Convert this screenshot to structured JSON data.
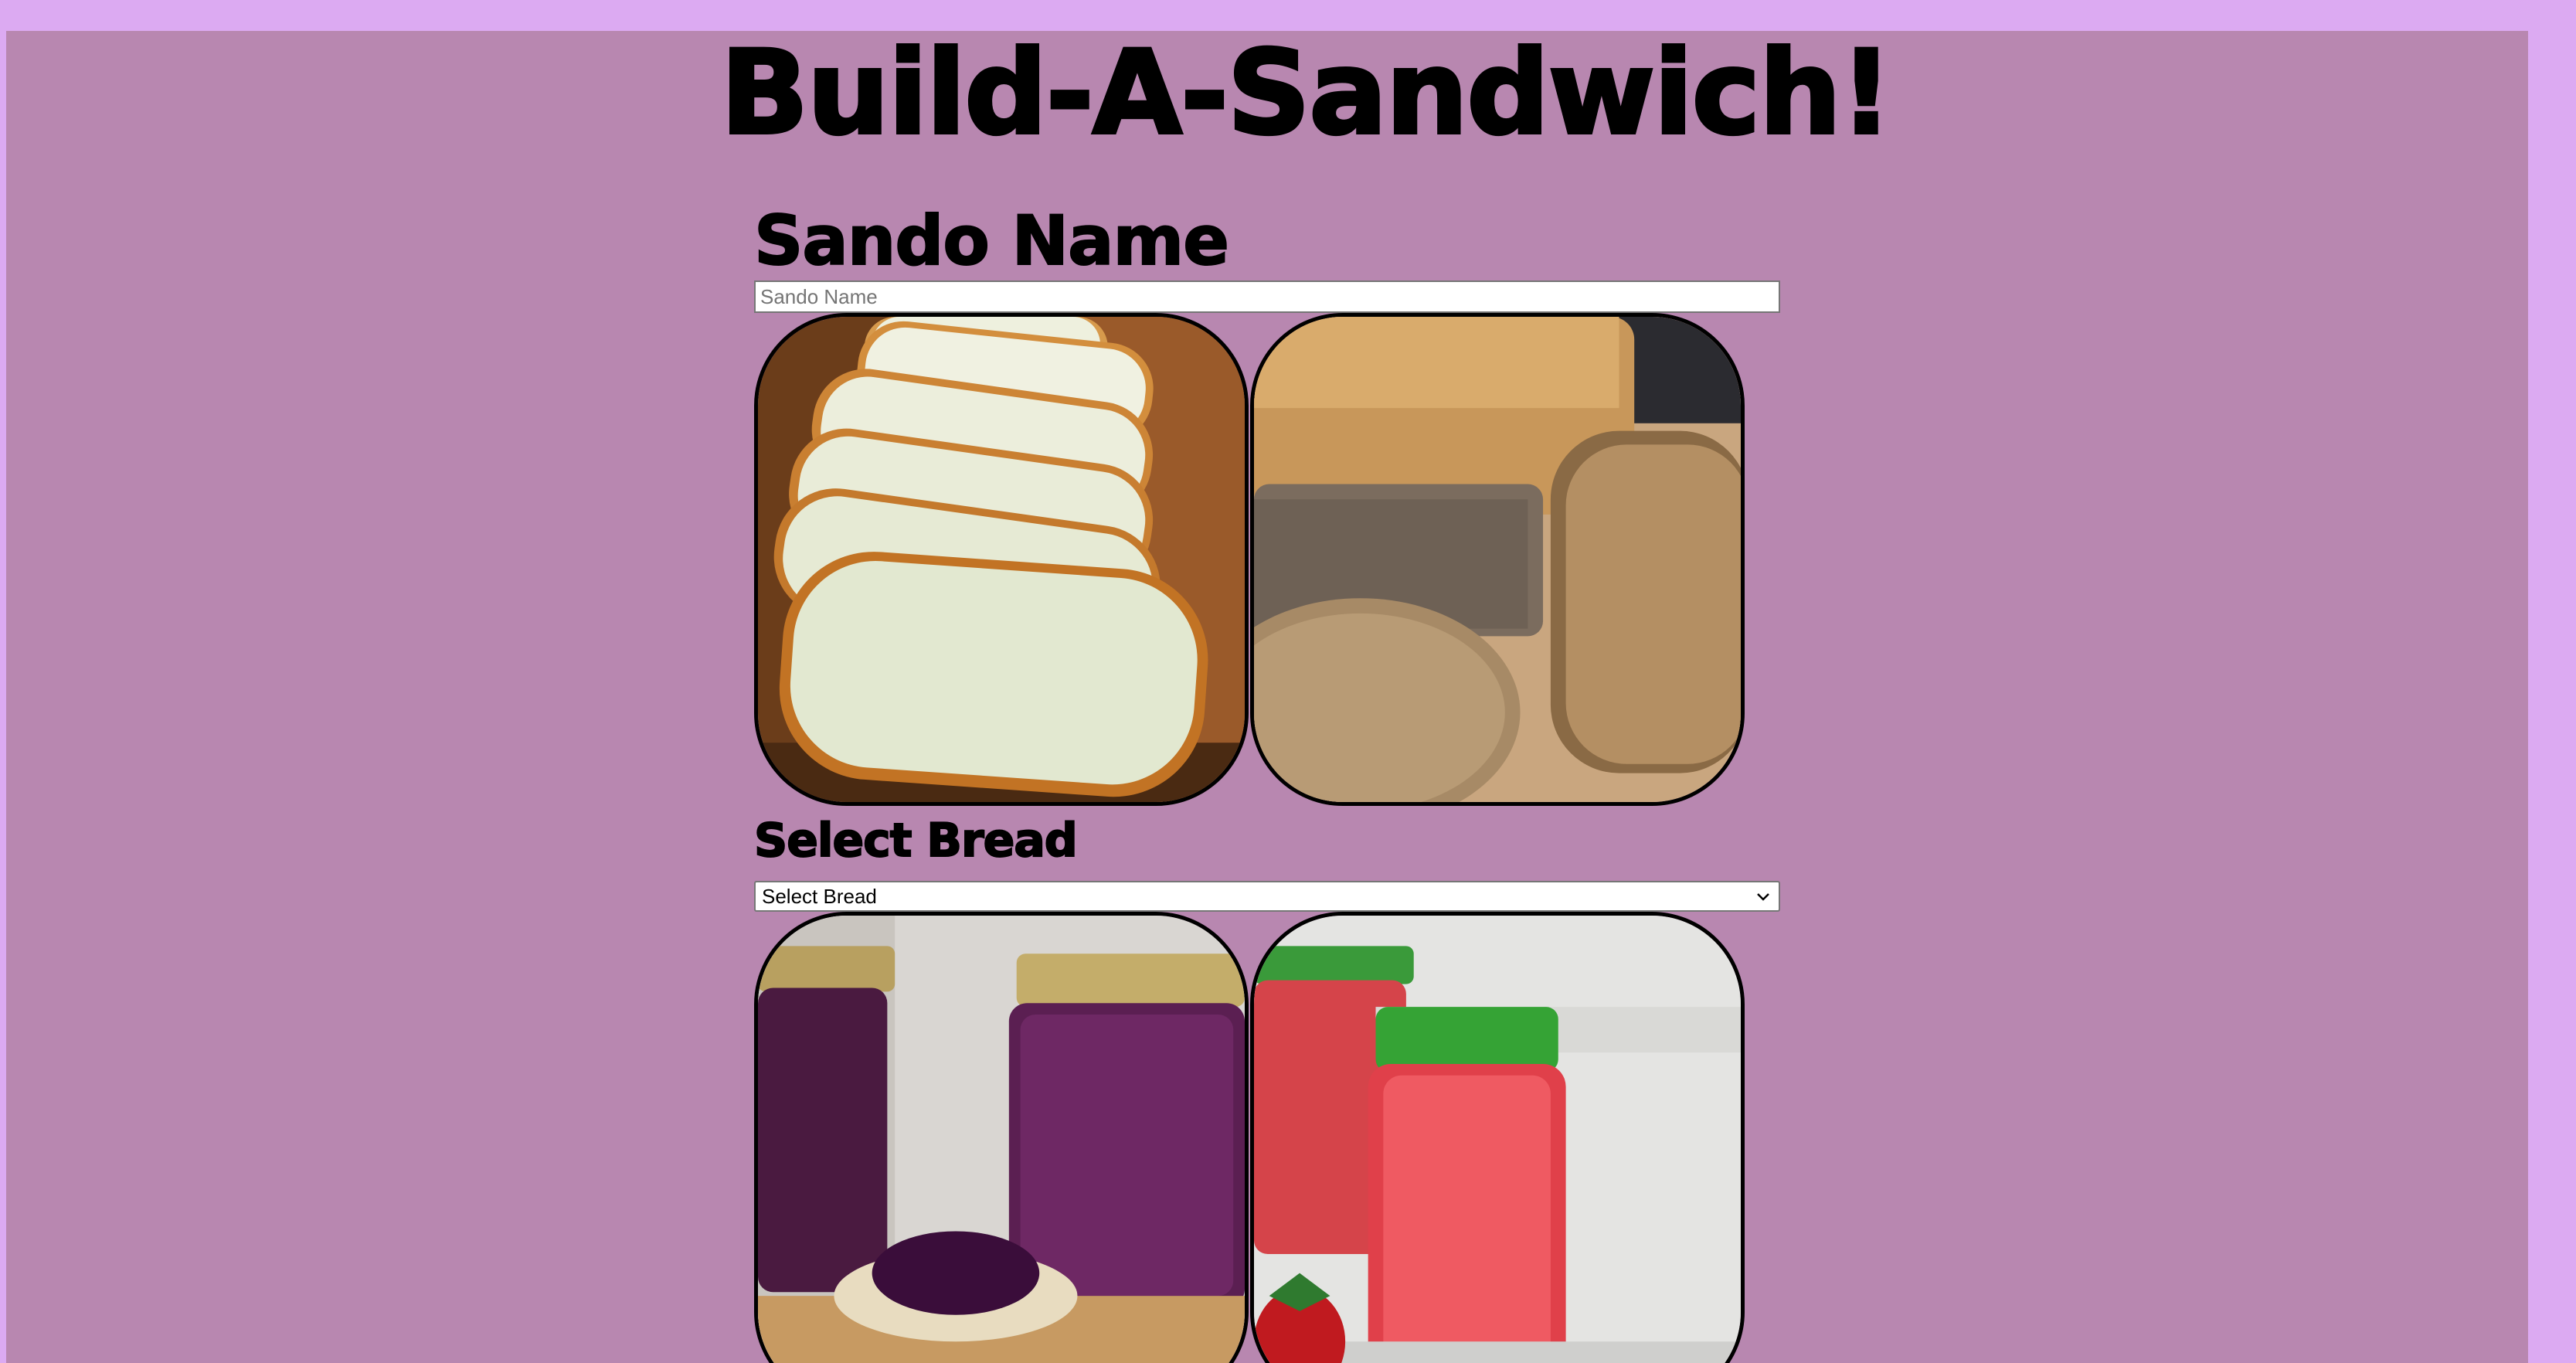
{
  "page": {
    "title": "Build-A-Sandwich!",
    "background_color": "#dcaaf2",
    "panel_color": "#b887b0"
  },
  "form": {
    "name_heading": "Sando Name",
    "name_placeholder": "Sando Name",
    "name_value": "",
    "bread_heading": "Select Bread",
    "bread_select_value": "Select Bread"
  },
  "images": [
    {
      "name": "white-bread-slices-image",
      "icon": "white-bread-image"
    },
    {
      "name": "wheat-bread-loaf-image",
      "icon": "wheat-bread-image"
    },
    {
      "name": "grape-jelly-jars-image",
      "icon": "grape-jelly-image"
    },
    {
      "name": "strawberry-jelly-jars-image",
      "icon": "strawberry-jelly-image"
    }
  ]
}
